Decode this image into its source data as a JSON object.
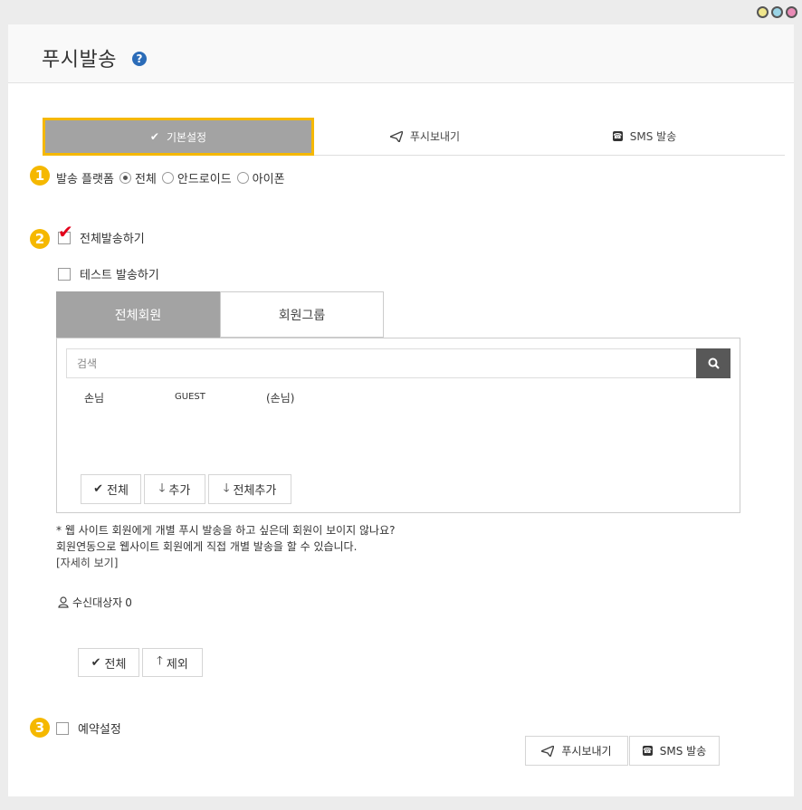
{
  "window": {
    "dots": [
      "#f0e68c",
      "#9ad4e6",
      "#e98bb6"
    ]
  },
  "page": {
    "title": "푸시발송",
    "help_icon": "?"
  },
  "tabs": [
    {
      "label": "기본설정",
      "icon": "check-icon"
    },
    {
      "label": "푸시보내기",
      "icon": "paper-plane-icon"
    },
    {
      "label": "SMS 발송",
      "icon": "phone-icon"
    }
  ],
  "step1": {
    "number": "1",
    "label": "발송 플랫폼",
    "options": [
      "전체",
      "안드로이드",
      "아이폰"
    ],
    "selected": "전체"
  },
  "step2": {
    "number": "2",
    "send_all_label": "전체발송하기",
    "test_send_label": "테스트 발송하기"
  },
  "member_tabs": [
    "전체회원",
    "회원그룹"
  ],
  "search": {
    "placeholder": "검색"
  },
  "member_row": {
    "name": "손님",
    "id": "GUEST",
    "nickname": "(손님)"
  },
  "member_buttons": {
    "all": "전체",
    "add": "추가",
    "add_all": "전체추가"
  },
  "info": {
    "line1": "* 웹 사이트 회원에게 개별 푸시 발송을 하고 싶은데 회원이 보이지 않나요?",
    "line2": "회원연동으로 웹사이트 회원에게 직접 개별 발송을 할 수 있습니다.",
    "link": "[자세히 보기]"
  },
  "recipients": {
    "label": "수신대상자",
    "count": "0"
  },
  "recipient_buttons": {
    "all": "전체",
    "remove": "제외"
  },
  "step3": {
    "number": "3",
    "label": "예약설정"
  },
  "footer": {
    "push_label": "푸시보내기",
    "sms_label": "SMS 발송"
  }
}
